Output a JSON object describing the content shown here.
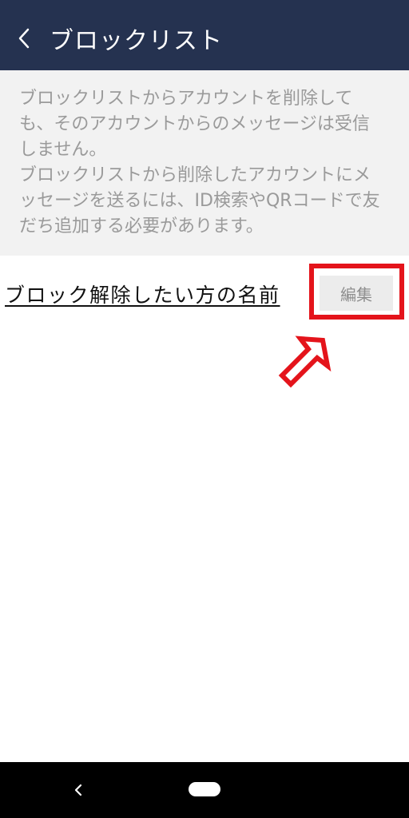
{
  "header": {
    "title": "ブロックリスト",
    "back_icon": "chevron-left-icon"
  },
  "info": {
    "line1": "ブロックリストからアカウントを削除して",
    "line2": "も、そのアカウントからのメッセージは受信",
    "line3": "しません。",
    "line4": "ブロックリストから削除したアカウントにメ",
    "line5": "ッセージを送るには、ID検索やQRコードで友",
    "line6": "だち追加する必要があります。"
  },
  "blocked_list": {
    "items": [
      {
        "name": "ブロック解除したい方の名前",
        "edit_label": "編集"
      }
    ]
  },
  "annotation": {
    "highlight_color": "#e4141b",
    "arrow_icon": "up-arrow-outline-icon"
  },
  "colors": {
    "header_bg": "#253250",
    "info_bg": "#f2f2f2",
    "info_text": "#9a9a9a"
  },
  "nav": {
    "back_icon": "nav-back-icon",
    "home_icon": "home-pill-icon"
  }
}
